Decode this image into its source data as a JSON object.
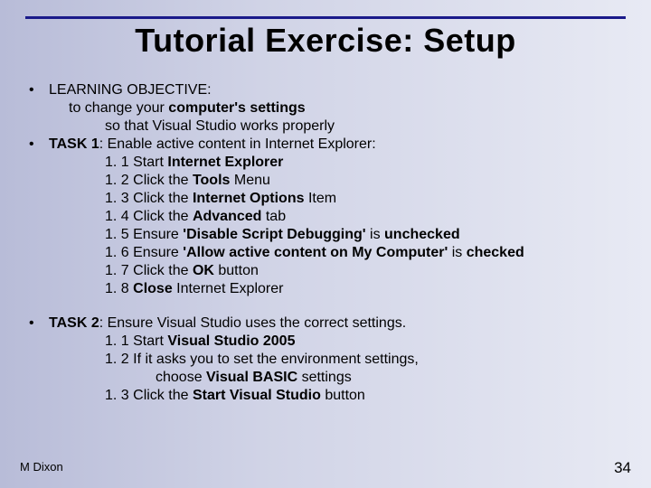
{
  "title": "Tutorial Exercise: Setup",
  "sections": {
    "learning": {
      "label": "LEARNING OBJECTIVE:",
      "line1_a": "to change your ",
      "line1_b": "computer's settings",
      "line2": "so that Visual Studio works properly"
    },
    "task1": {
      "label_a": "TASK 1",
      "label_b": ": Enable active content in Internet Explorer:",
      "s1_a": "1. 1 Start ",
      "s1_b": "Internet Explorer",
      "s2_a": "1. 2 Click the ",
      "s2_b": "Tools",
      "s2_c": " Menu",
      "s3_a": "1. 3 Click the ",
      "s3_b": "Internet Options",
      "s3_c": " Item",
      "s4_a": "1. 4 Click the ",
      "s4_b": "Advanced",
      "s4_c": " tab",
      "s5_a": "1. 5 Ensure ",
      "s5_b": "'Disable Script Debugging'",
      "s5_c": " is ",
      "s5_d": "unchecked",
      "s6_a": "1. 6 Ensure ",
      "s6_b": "'Allow active content on My Computer'",
      "s6_c": " is ",
      "s6_d": "checked",
      "s7_a": "1. 7 Click the ",
      "s7_b": "OK",
      "s7_c": " button",
      "s8_a": "1. 8 ",
      "s8_b": "Close",
      "s8_c": " Internet Explorer"
    },
    "task2": {
      "label_a": "TASK 2",
      "label_b": ": Ensure Visual Studio uses the correct settings.",
      "s1_a": "1. 1 Start ",
      "s1_b": "Visual Studio 2005",
      "s2": "1. 2 If it asks you to set the environment settings,",
      "s2b_a": "choose ",
      "s2b_b": "Visual BASIC",
      "s2b_c": " settings",
      "s3_a": "1. 3 Click the ",
      "s3_b": "Start Visual Studio",
      "s3_c": " button"
    }
  },
  "footer": {
    "author": "M Dixon",
    "page": "34"
  }
}
